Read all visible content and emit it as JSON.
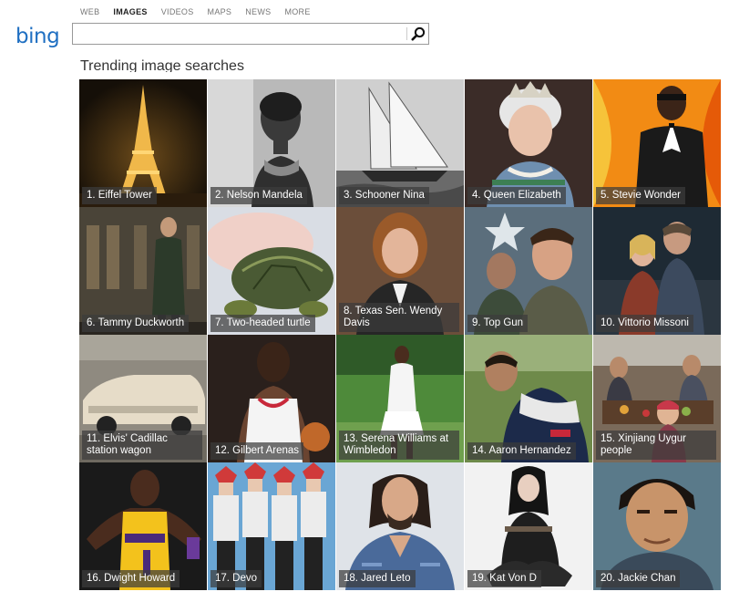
{
  "nav": {
    "items": [
      {
        "label": "WEB",
        "active": false
      },
      {
        "label": "IMAGES",
        "active": true
      },
      {
        "label": "VIDEOS",
        "active": false
      },
      {
        "label": "MAPS",
        "active": false
      },
      {
        "label": "NEWS",
        "active": false
      },
      {
        "label": "MORE",
        "active": false
      }
    ]
  },
  "logo": {
    "text": "bing"
  },
  "search": {
    "value": "",
    "placeholder": ""
  },
  "section": {
    "title": "Trending image searches"
  },
  "tiles": [
    {
      "label": "1. Eiffel Tower"
    },
    {
      "label": "2. Nelson Mandela"
    },
    {
      "label": "3. Schooner Nina"
    },
    {
      "label": "4. Queen Elizabeth"
    },
    {
      "label": "5. Stevie Wonder"
    },
    {
      "label": "6. Tammy Duckworth"
    },
    {
      "label": "7. Two-headed turtle"
    },
    {
      "label": "8. Texas Sen. Wendy Davis"
    },
    {
      "label": "9. Top Gun"
    },
    {
      "label": "10. Vittorio Missoni"
    },
    {
      "label": "11. Elvis' Cadillac station wagon"
    },
    {
      "label": "12. Gilbert Arenas"
    },
    {
      "label": "13. Serena Williams at Wimbledon"
    },
    {
      "label": "14. Aaron Hernandez"
    },
    {
      "label": "15. Xinjiang Uygur people",
      "selected": true
    },
    {
      "label": "16. Dwight Howard"
    },
    {
      "label": "17. Devo"
    },
    {
      "label": "18. Jared Leto"
    },
    {
      "label": "19. Kat Von D"
    },
    {
      "label": "20. Jackie Chan"
    }
  ],
  "colors": {
    "brand": "#1f6fc2",
    "highlight": "#e8101c"
  },
  "icons": {
    "search": "magnifier-icon"
  }
}
